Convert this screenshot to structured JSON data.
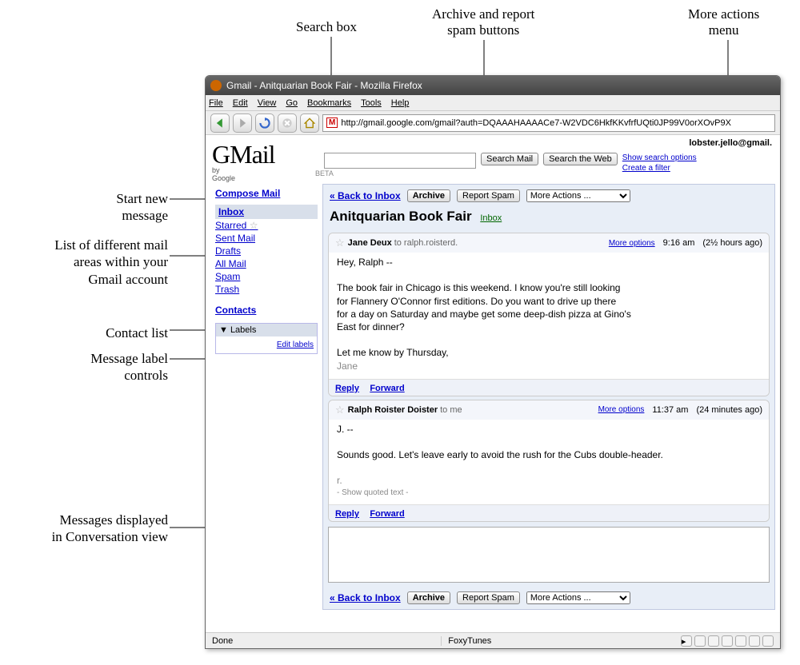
{
  "annotations": {
    "top": {
      "search": "Search box",
      "archive": "Archive and report\nspam buttons",
      "more": "More actions\nmenu"
    },
    "left": {
      "compose": "Start new\nmessage",
      "folders": "List of different mail\nareas within your\nGmail account",
      "contacts": "Contact list",
      "labels": "Message label\ncontrols",
      "convo": "Messages displayed\nin Conversation view"
    }
  },
  "browser": {
    "title": "Gmail - Anitquarian Book Fair - Mozilla Firefox",
    "menus": [
      "File",
      "Edit",
      "View",
      "Go",
      "Bookmarks",
      "Tools",
      "Help"
    ],
    "url": "http://gmail.google.com/gmail?auth=DQAAAHAAAACe7-W2VDC6HkfKKvfrfUQti0JP99V0orXOvP9X",
    "status_left": "Done",
    "status_mid": "FoxyTunes"
  },
  "gmail": {
    "logo_main": "GMail",
    "logo_by": "by Google",
    "logo_beta": "BETA",
    "account": "lobster.jello@gmail.",
    "search_mail": "Search Mail",
    "search_web": "Search the Web",
    "search_opts": "Show search options",
    "create_filter": "Create a filter",
    "sidebar": {
      "compose": "Compose Mail",
      "inbox": "Inbox",
      "starred": "Starred",
      "sent": "Sent Mail",
      "drafts": "Drafts",
      "all": "All Mail",
      "spam": "Spam",
      "trash": "Trash",
      "contacts": "Contacts",
      "labels_head": "▼ Labels",
      "edit_labels": "Edit labels"
    },
    "toolbar": {
      "back": "« Back to Inbox",
      "archive": "Archive",
      "spam": "Report Spam",
      "more": "More Actions ..."
    },
    "conversation": {
      "title": "Anitquarian Book Fair",
      "label": "Inbox"
    },
    "messages": [
      {
        "sender": "Jane Deux",
        "to": "to ralph.roisterd.",
        "more": "More options",
        "time": "9:16 am",
        "age": "(2½ hours ago)",
        "body_lines": [
          "Hey, Ralph --",
          "",
          "The book fair in Chicago is this weekend. I know you're still looking",
          "for Flannery O'Connor first editions. Do you want to drive up there",
          "for a day on Saturday and maybe get some deep-dish pizza at Gino's",
          "East for dinner?",
          "",
          "Let me know by Thursday,"
        ],
        "sig": "Jane",
        "reply": "Reply",
        "forward": "Forward"
      },
      {
        "sender": "Ralph Roister Doister",
        "to": "to me",
        "more": "More options",
        "time": "11:37 am",
        "age": "(24 minutes ago)",
        "body_lines": [
          "J. --",
          "",
          "Sounds good. Let's leave early to avoid the rush for the Cubs double-header.",
          ""
        ],
        "sig": "r.",
        "quoted": "- Show quoted text -",
        "reply": "Reply",
        "forward": "Forward"
      }
    ]
  }
}
